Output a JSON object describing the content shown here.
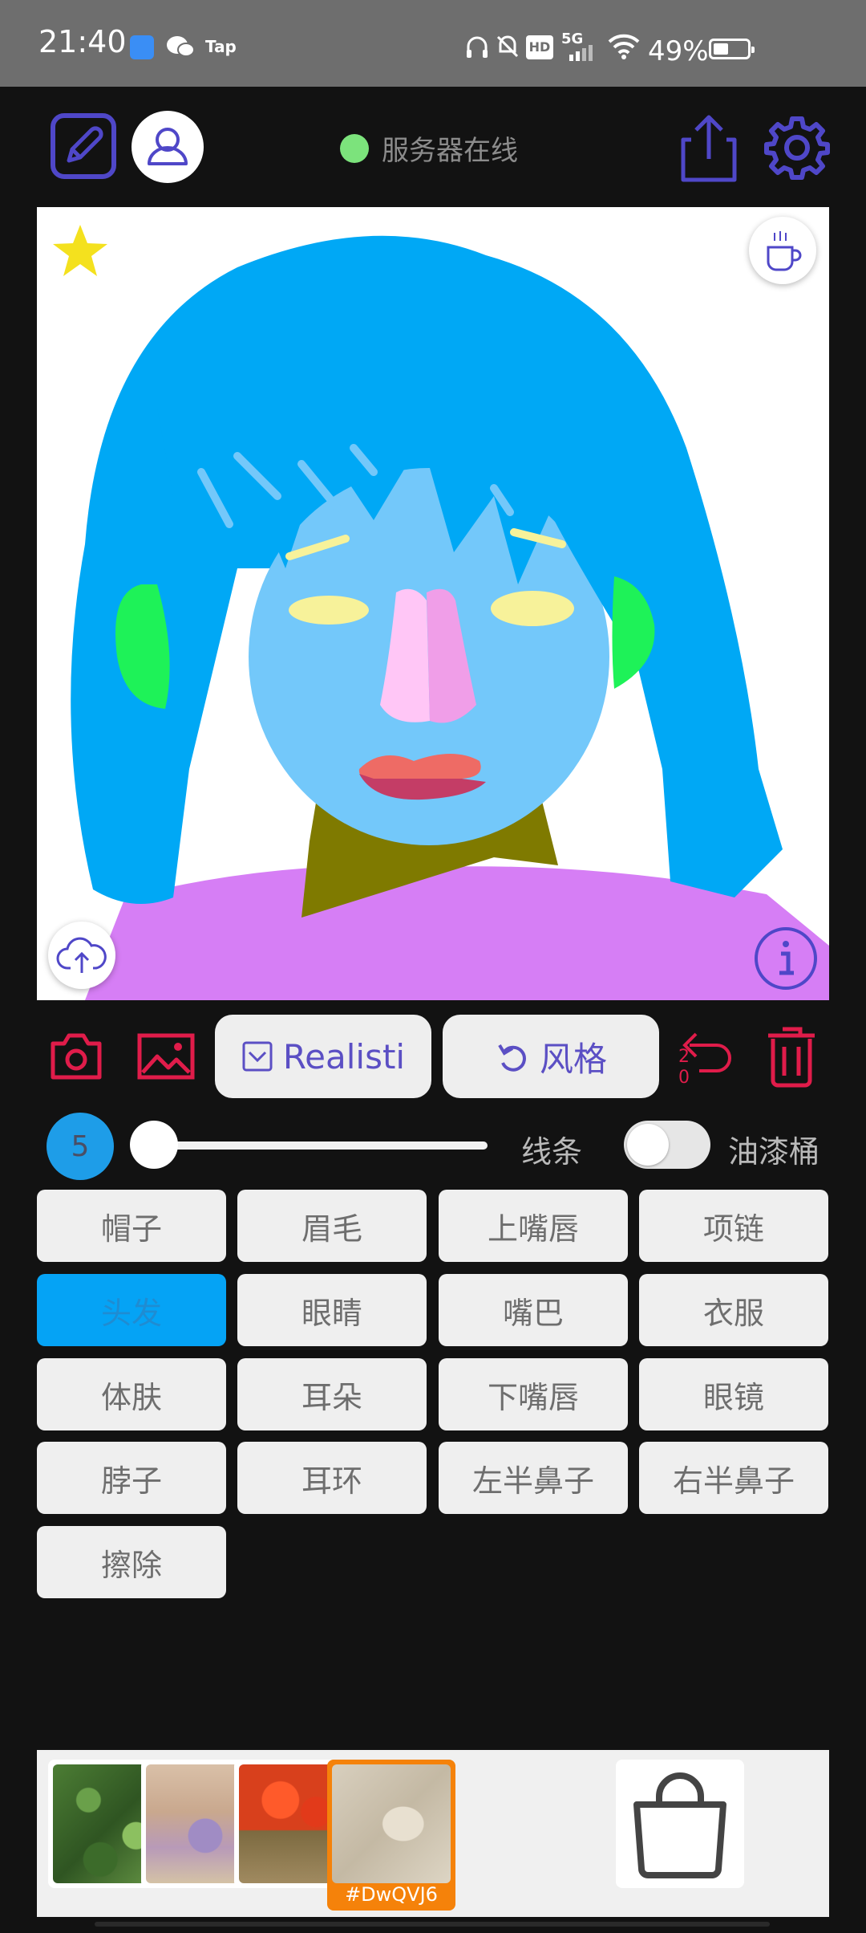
{
  "status_bar": {
    "time": "21:40",
    "app_icons": [
      "Tap"
    ],
    "network": "5G",
    "hd_badge": "HD",
    "battery_percent": "49%",
    "battery_level": 0.49
  },
  "header": {
    "server_status": "服务器在线",
    "server_status_color": "#7ce37c",
    "icons": [
      "edit-icon",
      "user-icon",
      "share-icon",
      "settings-icon"
    ]
  },
  "canvas": {
    "background": "#ffffff",
    "colors": {
      "hair": "#00a8f5",
      "skin": "#73c8fa",
      "neck": "#7f7a00",
      "clothes": "#d67ef5",
      "eyes": "#f7f29a",
      "ears": "#1ef258",
      "nose_left": "#ffc6f6",
      "nose_right": "#f09ee8",
      "upper_lip": "#ee6b65",
      "lower_lip": "#c43d66"
    }
  },
  "tools": {
    "style_toggle_label": "Realisti",
    "style_button_label": "风格",
    "undo_count_top": "2",
    "undo_count_bottom": "0",
    "accent_color": "#e01c4a"
  },
  "brush": {
    "size": "5",
    "slider_fraction": 0.0,
    "line_label": "线条",
    "bucket_label": "油漆桶",
    "bucket_enabled": false
  },
  "parts": [
    {
      "label": "帽子",
      "active": false
    },
    {
      "label": "眉毛",
      "active": false
    },
    {
      "label": "上嘴唇",
      "active": false
    },
    {
      "label": "项链",
      "active": false
    },
    {
      "label": "头发",
      "active": true
    },
    {
      "label": "眼睛",
      "active": false
    },
    {
      "label": "嘴巴",
      "active": false
    },
    {
      "label": "衣服",
      "active": false
    },
    {
      "label": "体肤",
      "active": false
    },
    {
      "label": "耳朵",
      "active": false
    },
    {
      "label": "下嘴唇",
      "active": false
    },
    {
      "label": "眼镜",
      "active": false
    },
    {
      "label": "脖子",
      "active": false
    },
    {
      "label": "耳环",
      "active": false
    },
    {
      "label": "左半鼻子",
      "active": false
    },
    {
      "label": "右半鼻子",
      "active": false
    },
    {
      "label": "擦除",
      "active": false
    }
  ],
  "styles_strip": {
    "thumbnails": [
      {
        "name": "green-moss-style"
      },
      {
        "name": "lavender-fabric-style"
      },
      {
        "name": "red-flowers-style"
      },
      {
        "name": "beige-sketch-style",
        "caption": "#DwQVJ6",
        "selected": true
      }
    ],
    "selected_color": "#f5820a",
    "shop_icon": "shopping-bag-icon"
  }
}
